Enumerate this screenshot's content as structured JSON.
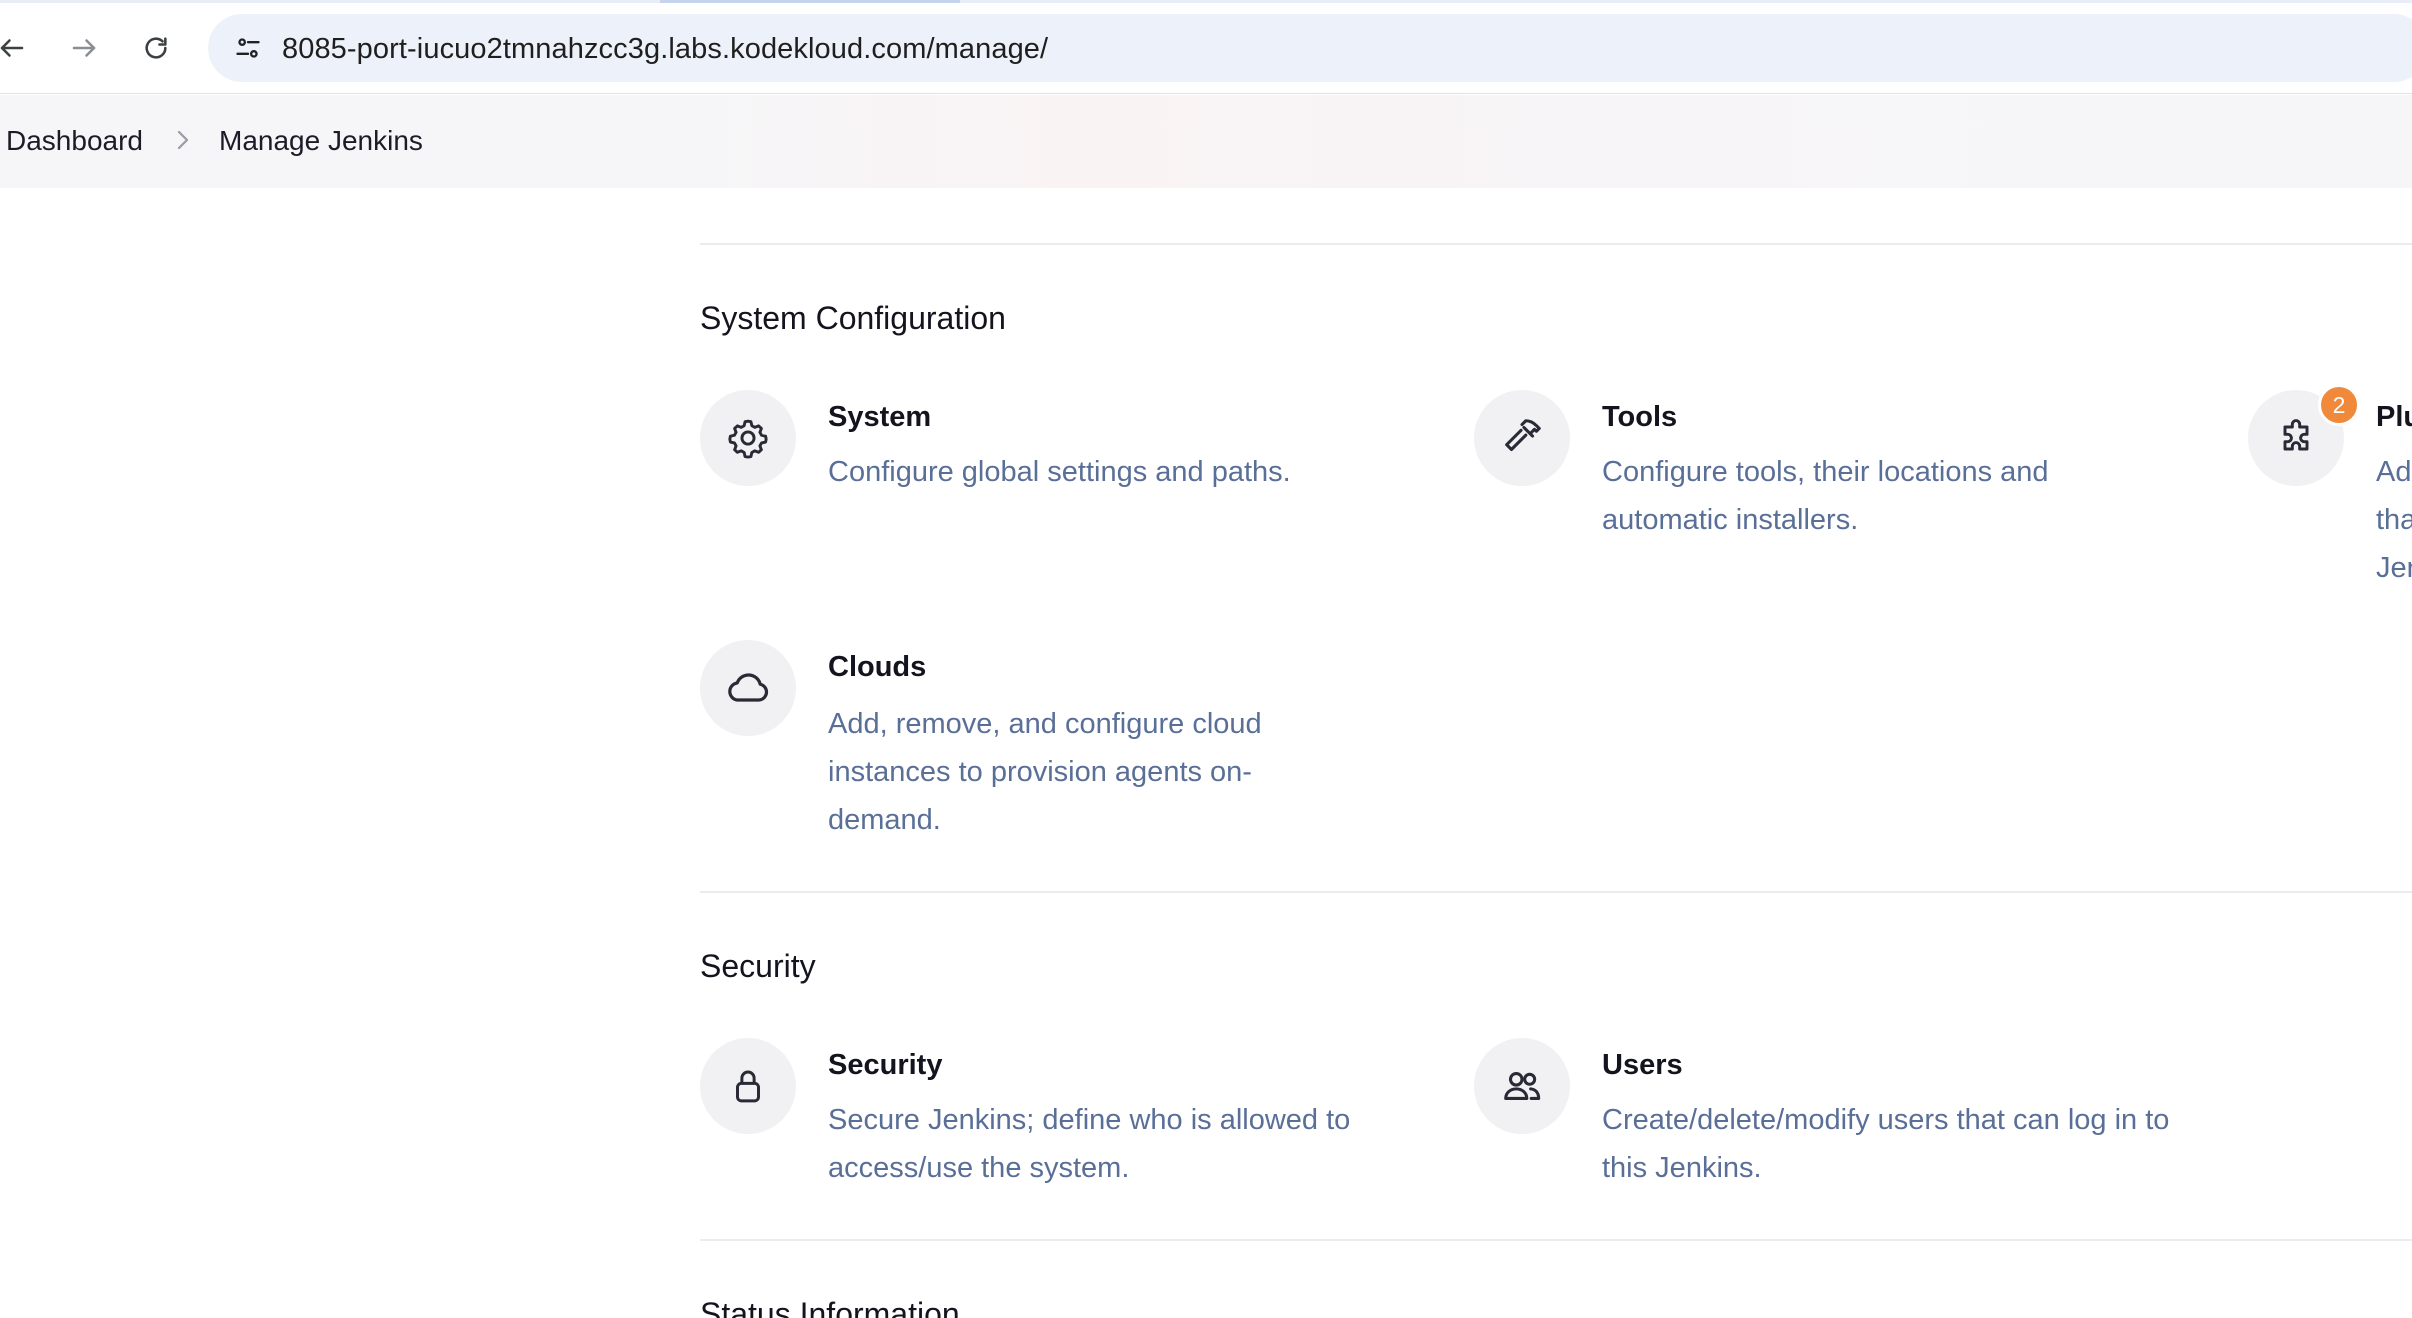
{
  "browser": {
    "url": "8085-port-iucuo2tmnahzcc3g.labs.kodekloud.com/manage/"
  },
  "breadcrumb": {
    "items": [
      "Dashboard",
      "Manage Jenkins"
    ]
  },
  "sections": {
    "system_configuration": {
      "title": "System Configuration",
      "items": [
        {
          "title": "System",
          "desc": "Configure global settings and paths.",
          "icon": "gear-icon"
        },
        {
          "title": "Tools",
          "desc": "Configure tools, their locations and automatic installers.",
          "icon": "hammer-icon"
        },
        {
          "title": "Plu",
          "desc": "Ad\ntha\nJer",
          "icon": "puzzle-icon",
          "badge": "2"
        },
        {
          "title": "Clouds",
          "desc": "Add, remove, and configure cloud instances to provision agents on-demand.",
          "icon": "cloud-icon"
        }
      ]
    },
    "security": {
      "title": "Security",
      "items": [
        {
          "title": "Security",
          "desc": "Secure Jenkins; define who is allowed to access/use the system.",
          "icon": "lock-icon"
        },
        {
          "title": "Users",
          "desc": "Create/delete/modify users that can log in to this Jenkins.",
          "icon": "users-icon"
        }
      ]
    },
    "status_information": {
      "title": "Status Information"
    }
  },
  "colors": {
    "description": "#5a6f98",
    "badge": "#f08a3a",
    "icon_bg": "#f1f1f4"
  }
}
